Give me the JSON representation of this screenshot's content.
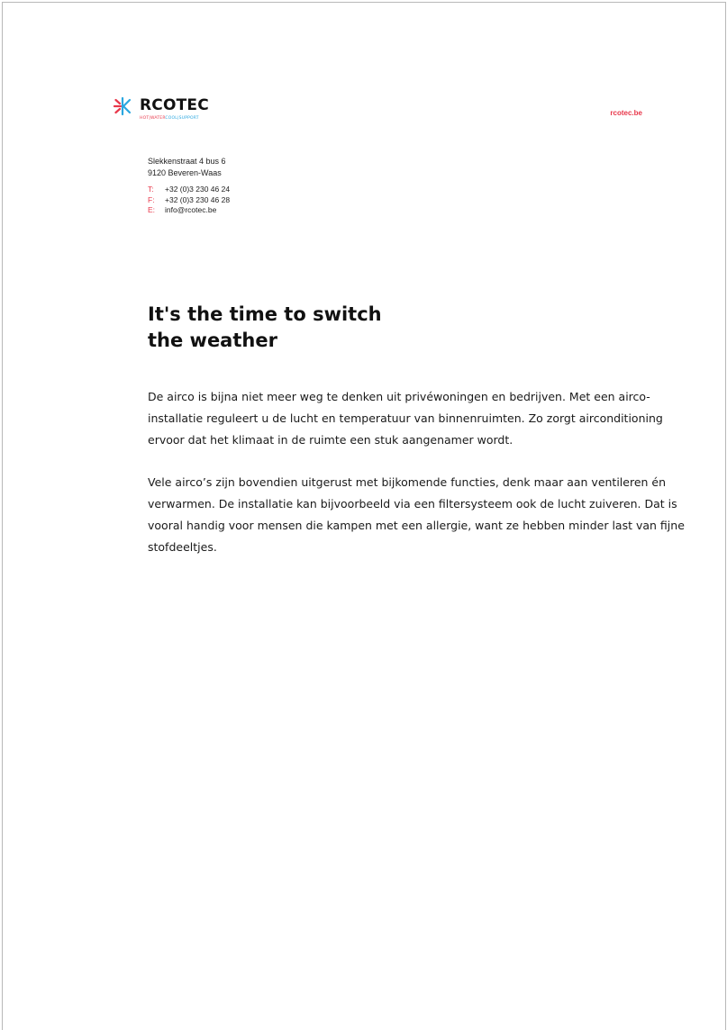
{
  "header": {
    "logo_name": "RCOTEC",
    "tagline_hot": "HOT|WATER",
    "tagline_cool": "COOL|SUPPORT",
    "site": "rcotec.be"
  },
  "address": {
    "line1": "Slekkenstraat 4 bus 6",
    "line2": "9120 Beveren-Waas"
  },
  "contact": {
    "phone_key": "T:",
    "phone": "+32 (0)3 230 46 24",
    "fax_key": "F:",
    "fax": "+32 (0)3 230 46 28",
    "email_key": "E:",
    "email": "info@rcotec.be"
  },
  "article": {
    "headline_line1": "It's the time to switch",
    "headline_line2": "the weather",
    "paragraph1": "De airco is bijna niet meer weg te denken uit privéwoningen en bedrijven. Met een airco-installatie reguleert u de lucht en temperatuur van binnenruimten. Zo zorgt airconditioning ervoor dat het klimaat in de ruimte een stuk aangenamer wordt.",
    "paragraph2": "Vele airco’s zijn bovendien uitgerust met bijkomende functies, denk maar aan ventileren én verwarmen. De installatie kan bijvoorbeeld via een filtersysteem ook de lucht zuiveren. Dat is vooral handig voor mensen die kampen met een allergie, want ze hebben minder last van fijne stofdeeltjes."
  },
  "colors": {
    "accent_red": "#e8374a",
    "accent_blue": "#2aa7e0"
  }
}
